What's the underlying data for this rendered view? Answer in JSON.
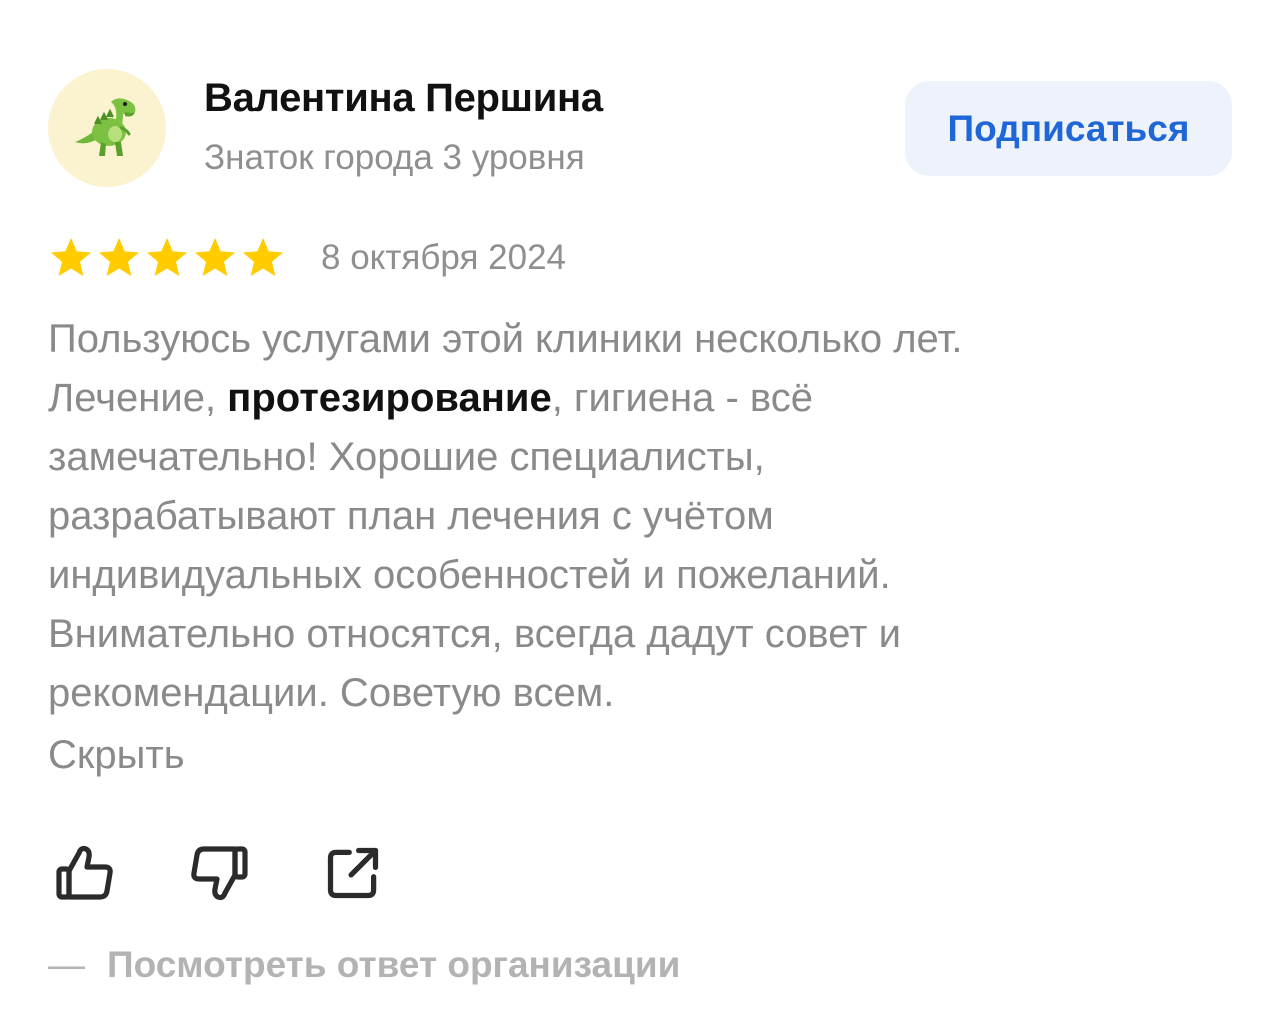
{
  "author": {
    "name": "Валентина Першина",
    "level": "Знаток города 3 уровня",
    "avatar_icon": "dinosaur-icon"
  },
  "subscribe_label": "Подписаться",
  "review": {
    "rating": 5,
    "rating_max": 5,
    "date": "8 октября 2024",
    "lines": [
      {
        "text": "Пользуюсь услугами этой клиники несколько лет."
      },
      {
        "before": "Лечение, ",
        "highlight": "протезирование",
        "after": ", гигиена - всё"
      },
      {
        "text": "замечательно! Хорошие специалисты,"
      },
      {
        "text": "разрабатывают план лечения с учётом"
      },
      {
        "text": "индивидуальных особенностей и пожеланий."
      },
      {
        "text": "Внимательно относятся, всегда дадут совет и"
      },
      {
        "text": "рекомендации. Советую всем."
      }
    ],
    "hide_label": "Скрыть"
  },
  "actions": {
    "like_icon": "thumbs-up-icon",
    "dislike_icon": "thumbs-down-icon",
    "share_icon": "share-icon"
  },
  "org_reply": {
    "dash": "—",
    "label": "Посмотреть ответ организации"
  },
  "colors": {
    "accent": "#1f66d6",
    "star": "#ffcc00",
    "text_muted": "#8a8a8a"
  }
}
